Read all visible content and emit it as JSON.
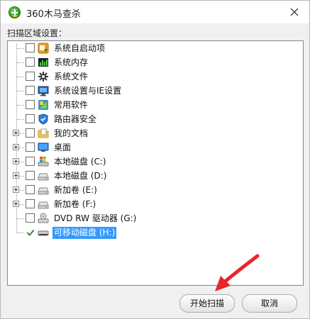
{
  "window": {
    "title": "360木马查杀"
  },
  "section": {
    "label": "扫描区域设置："
  },
  "tree": {
    "items": [
      {
        "label": "系统自启动项",
        "icon": "startup-icon",
        "expandable": false,
        "checked": false,
        "selected": false
      },
      {
        "label": "系统内存",
        "icon": "memory-icon",
        "expandable": false,
        "checked": false,
        "selected": false
      },
      {
        "label": "系统文件",
        "icon": "system-file-icon",
        "expandable": false,
        "checked": false,
        "selected": false
      },
      {
        "label": "系统设置与IE设置",
        "icon": "monitor-settings-icon",
        "expandable": false,
        "checked": false,
        "selected": false
      },
      {
        "label": "常用软件",
        "icon": "software-icon",
        "expandable": false,
        "checked": false,
        "selected": false
      },
      {
        "label": "路由器安全",
        "icon": "router-shield-icon",
        "expandable": false,
        "checked": false,
        "selected": false
      },
      {
        "label": "我的文档",
        "icon": "documents-folder-icon",
        "expandable": true,
        "checked": false,
        "selected": false
      },
      {
        "label": "桌面",
        "icon": "desktop-icon",
        "expandable": true,
        "checked": false,
        "selected": false
      },
      {
        "label": "本地磁盘 (C:)",
        "icon": "windows-drive-icon",
        "expandable": true,
        "checked": false,
        "selected": false
      },
      {
        "label": "本地磁盘 (D:)",
        "icon": "hard-drive-icon",
        "expandable": true,
        "checked": false,
        "selected": false
      },
      {
        "label": "新加卷 (E:)",
        "icon": "hard-drive-icon",
        "expandable": true,
        "checked": false,
        "selected": false
      },
      {
        "label": "新加卷 (F:)",
        "icon": "hard-drive-icon",
        "expandable": true,
        "checked": false,
        "selected": false
      },
      {
        "label": "DVD RW 驱动器 (G:)",
        "icon": "dvd-drive-icon",
        "expandable": false,
        "checked": false,
        "selected": false
      },
      {
        "label": "可移动磁盘 (H:)",
        "icon": "removable-drive-icon",
        "expandable": false,
        "checked": true,
        "selected": true
      }
    ]
  },
  "buttons": {
    "scan": "开始扫描",
    "cancel": "取消"
  },
  "colors": {
    "selection": "#3399ff",
    "annotation_arrow": "#e8262b",
    "logo_green": "#3aa52a"
  }
}
